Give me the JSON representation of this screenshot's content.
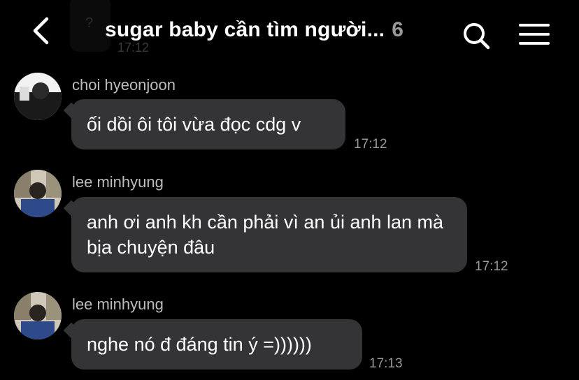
{
  "header": {
    "title": "sugar baby cần tìm người...",
    "member_count": "6",
    "icons": [
      "back-icon",
      "search-icon",
      "menu-icon"
    ]
  },
  "background_time": "17:12",
  "messages": [
    {
      "sender": "choi hyeonjoon",
      "text": "ối dồi ôi tôi vừa đọc cdg v",
      "time": "17:12"
    },
    {
      "sender": "lee minhyung",
      "text": "anh ơi anh kh cần phải vì an ủi anh lan mà bịa chuyện đâu",
      "time": "17:12"
    },
    {
      "sender": "lee minhyung",
      "text": "nghe nó đ đáng tin ý =))))))",
      "time": "17:13"
    }
  ],
  "colors": {
    "background": "#000000",
    "bubble": "#343436",
    "sender_name": "#bdbdbd",
    "timestamp": "#9a9a9a",
    "member_count": "#9a9a9a"
  }
}
